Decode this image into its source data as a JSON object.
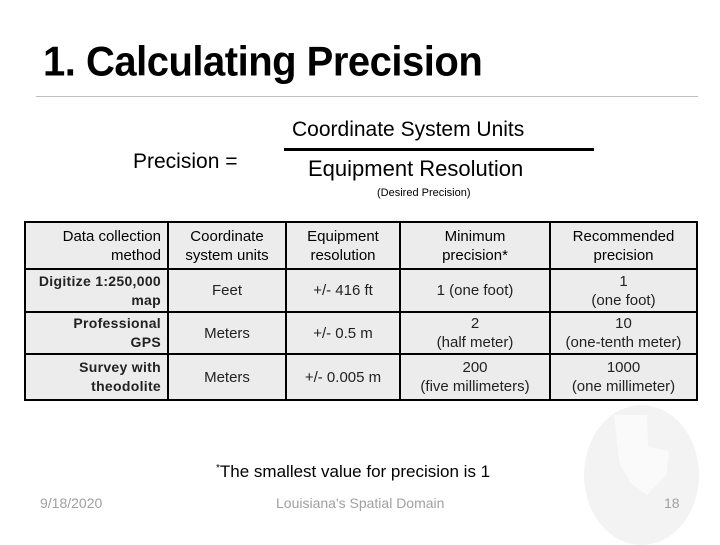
{
  "slide": {
    "title": "1. Calculating Precision",
    "formula": {
      "label": "Precision =",
      "numerator": "Coordinate System Units",
      "denominator": "Equipment Resolution",
      "denominator_note": "(Desired Precision)"
    },
    "table": {
      "headers": [
        [
          "Data collection",
          "method"
        ],
        [
          "Coordinate",
          "system units"
        ],
        [
          "Equipment",
          "resolution"
        ],
        [
          "Minimum",
          "precision*"
        ],
        [
          "Recommended",
          "precision"
        ]
      ],
      "rows": [
        {
          "method": [
            "Digitize 1:250,000",
            "map"
          ],
          "units": "Feet",
          "resolution": "+/- 416 ft",
          "minimum": [
            "1 (one foot)"
          ],
          "recommended": [
            "1",
            "(one foot)"
          ]
        },
        {
          "method": [
            "Professional",
            "GPS"
          ],
          "units": "Meters",
          "resolution": "+/- 0.5 m",
          "minimum": [
            "2",
            "(half meter)"
          ],
          "recommended": [
            "10",
            "(one-tenth meter)"
          ]
        },
        {
          "method": [
            "Survey with",
            "theodolite"
          ],
          "units": "Meters",
          "resolution": "+/- 0.005 m",
          "minimum": [
            "200",
            "(five millimeters)"
          ],
          "recommended": [
            "1000",
            "(one millimeter)"
          ]
        }
      ]
    },
    "footnote": {
      "marker": "*",
      "text": "The smallest value for precision is 1"
    },
    "footer": {
      "date": "9/18/2020",
      "center": "Louisiana's Spatial Domain",
      "page": "18"
    },
    "watermark_icon": "louisiana-globe-icon"
  }
}
